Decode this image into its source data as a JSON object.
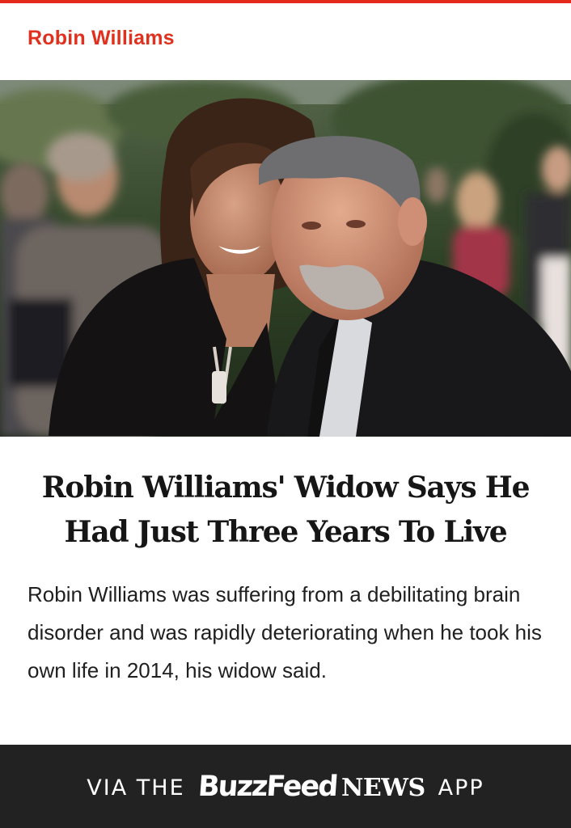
{
  "colors": {
    "accent": "#e32a1d",
    "headline": "#161616",
    "footer_bg": "#222222"
  },
  "article": {
    "category": "Robin Williams",
    "headline": "Robin Williams' Widow Says He Had Just Three Years To Live",
    "summary": "Robin Williams was suffering from a debilitating brain disorder and was rapidly deteriorating when he took his own life in 2014, his widow said."
  },
  "footer": {
    "via": "VIA THE",
    "brand_buzz": "BuzzFeed",
    "brand_news": "NEWS",
    "app": "APP"
  }
}
